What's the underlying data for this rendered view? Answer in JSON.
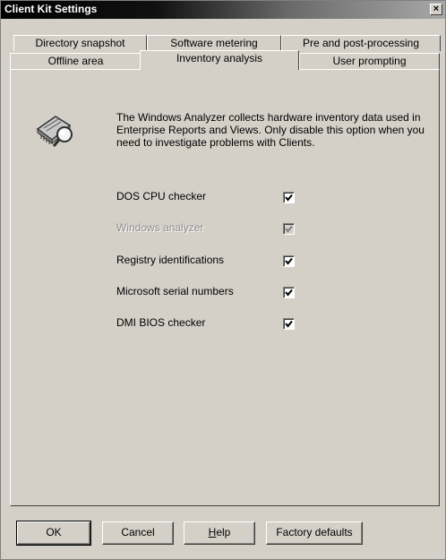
{
  "window": {
    "title": "Client Kit Settings",
    "close_glyph": "×"
  },
  "tabs": {
    "back_row": [
      "Directory snapshot",
      "Software metering",
      "Pre and post-processing"
    ],
    "front_row": [
      "Offline area",
      "Inventory analysis",
      "User prompting"
    ],
    "active": "Inventory analysis"
  },
  "panel": {
    "icon": "hardware-analyzer-icon",
    "description": "The Windows Analyzer collects hardware inventory data used in Enterprise Reports and Views. Only disable this option when you need  to investigate problems with Clients.",
    "options": [
      {
        "label": "DOS CPU checker",
        "checked": true,
        "enabled": true
      },
      {
        "label": "Windows analyzer",
        "checked": true,
        "enabled": false
      },
      {
        "label": "Registry identifications",
        "checked": true,
        "enabled": true
      },
      {
        "label": "Microsoft serial numbers",
        "checked": true,
        "enabled": true
      },
      {
        "label": "DMI BIOS checker",
        "checked": true,
        "enabled": true
      }
    ]
  },
  "buttons": {
    "ok": "OK",
    "cancel": "Cancel",
    "help_mnemonic": "H",
    "help_rest": "elp",
    "factory_defaults": "Factory defaults"
  }
}
